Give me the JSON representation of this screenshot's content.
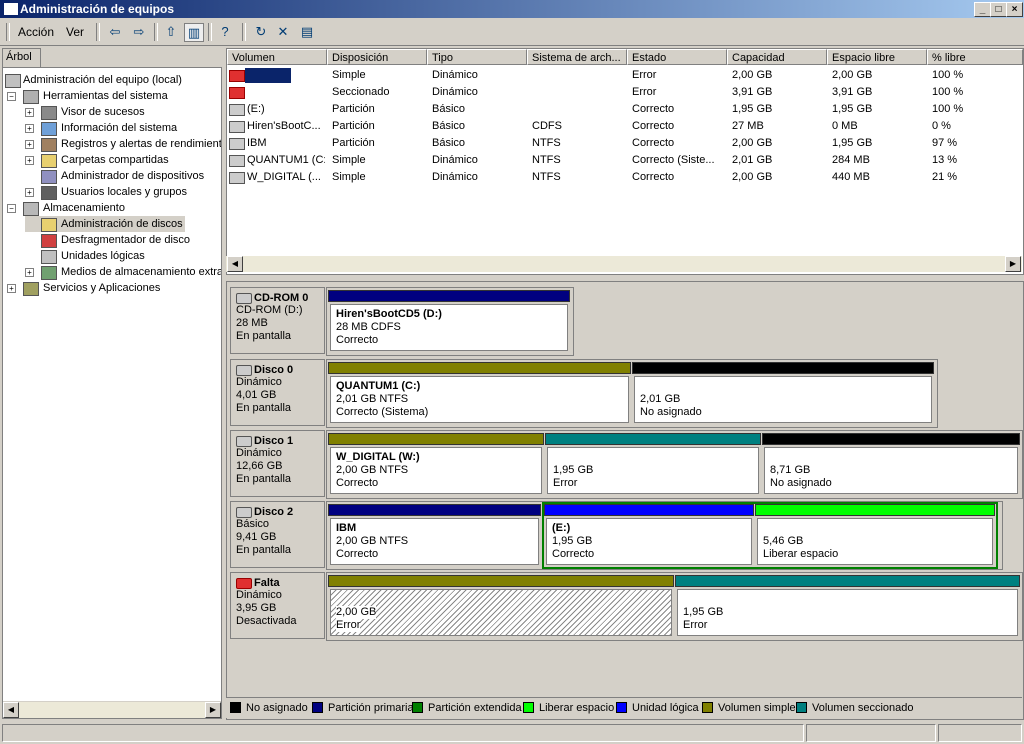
{
  "window": {
    "title": "Administración de equipos"
  },
  "menu": {
    "action": "Acción",
    "view": "Ver"
  },
  "tree": {
    "tab": "Árbol",
    "root": "Administración del equipo (local)",
    "tools": "Herramientas del sistema",
    "event_viewer": "Visor de sucesos",
    "sysinfo": "Información del sistema",
    "perf": "Registros y alertas de rendimient",
    "shared": "Carpetas compartidas",
    "devmgr": "Administrador de dispositivos",
    "users": "Usuarios locales y grupos",
    "storage": "Almacenamiento",
    "diskmgmt": "Administración de discos",
    "defrag": "Desfragmentador de disco",
    "logical": "Unidades lógicas",
    "removable": "Medios de almacenamiento extraí",
    "services": "Servicios y Aplicaciones"
  },
  "list": {
    "headers": [
      "Volumen",
      "Disposición",
      "Tipo",
      "Sistema de arch...",
      "Estado",
      "Capacidad",
      "Espacio libre",
      "% libre"
    ],
    "rows": [
      [
        "",
        "Simple",
        "Dinámico",
        "",
        "Error",
        "2,00 GB",
        "2,00 GB",
        "100 %"
      ],
      [
        "",
        "Seccionado",
        "Dinámico",
        "",
        "Error",
        "3,91 GB",
        "3,91 GB",
        "100 %"
      ],
      [
        "(E:)",
        "Partición",
        "Básico",
        "",
        "Correcto",
        "1,95 GB",
        "1,95 GB",
        "100 %"
      ],
      [
        "Hiren'sBootC...",
        "Partición",
        "Básico",
        "CDFS",
        "Correcto",
        "27 MB",
        "0 MB",
        "0 %"
      ],
      [
        "IBM",
        "Partición",
        "Básico",
        "NTFS",
        "Correcto",
        "2,00 GB",
        "1,95 GB",
        "97 %"
      ],
      [
        "QUANTUM1 (C:)",
        "Simple",
        "Dinámico",
        "NTFS",
        "Correcto (Siste...",
        "2,01 GB",
        "284 MB",
        "13 %"
      ],
      [
        "W_DIGITAL (...",
        "Simple",
        "Dinámico",
        "NTFS",
        "Correcto",
        "2,00 GB",
        "440 MB",
        "21 %"
      ]
    ]
  },
  "disks": {
    "cd": {
      "name": "CD-ROM 0",
      "l1": "CD-ROM (D:)",
      "l2": "28 MB",
      "l3": "En pantalla",
      "p1": {
        "name": "Hiren'sBootCD5  (D:)",
        "size": "28 MB CDFS",
        "status": "Correcto"
      }
    },
    "d0": {
      "name": "Disco 0",
      "l1": "Dinámico",
      "l2": "4,01 GB",
      "l3": "En pantalla",
      "p1": {
        "name": "QUANTUM1  (C:)",
        "size": "2,01 GB NTFS",
        "status": "Correcto (Sistema)"
      },
      "p2": {
        "size": "2,01 GB",
        "status": "No asignado"
      }
    },
    "d1": {
      "name": "Disco 1",
      "l1": "Dinámico",
      "l2": "12,66 GB",
      "l3": "En pantalla",
      "p1": {
        "name": "W_DIGITAL  (W:)",
        "size": "2,00 GB NTFS",
        "status": "Correcto"
      },
      "p2": {
        "size": "1,95 GB",
        "status": "Error"
      },
      "p3": {
        "size": "8,71 GB",
        "status": "No asignado"
      }
    },
    "d2": {
      "name": "Disco 2",
      "l1": "Básico",
      "l2": "9,41 GB",
      "l3": "En pantalla",
      "p1": {
        "name": "IBM",
        "size": "2,00 GB NTFS",
        "status": "Correcto"
      },
      "p2": {
        "name": "(E:)",
        "size": "1,95 GB",
        "status": "Correcto"
      },
      "p3": {
        "size": "5,46 GB",
        "status": "Liberar espacio"
      }
    },
    "missing": {
      "name": "Falta",
      "l1": "Dinámico",
      "l2": "3,95 GB",
      "l3": "Desactivada",
      "p1": {
        "size": "2,00 GB",
        "status": "Error"
      },
      "p2": {
        "size": "1,95 GB",
        "status": "Error"
      }
    }
  },
  "legend": {
    "unallocated": "No asignado",
    "primary": "Partición primaria",
    "extended": "Partición extendida",
    "free": "Liberar espacio",
    "logical": "Unidad lógica",
    "simple": "Volumen simple",
    "striped": "Volumen seccionado"
  },
  "colors": {
    "unallocated": "#000000",
    "primary": "#000080",
    "extended": "#008000",
    "free": "#00ff00",
    "logical": "#0000ff",
    "simple": "#808000",
    "striped": "#008080"
  }
}
